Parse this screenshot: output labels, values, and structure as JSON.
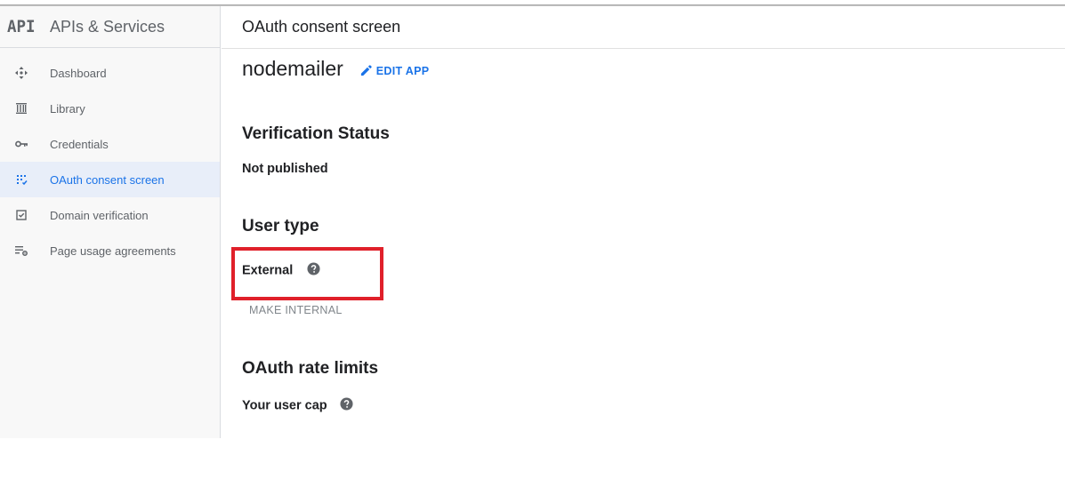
{
  "sidebar": {
    "logo_text": "API",
    "title": "APIs & Services",
    "items": [
      {
        "label": "Dashboard",
        "icon": "dashboard-icon"
      },
      {
        "label": "Library",
        "icon": "library-icon"
      },
      {
        "label": "Credentials",
        "icon": "key-icon"
      },
      {
        "label": "OAuth consent screen",
        "icon": "consent-grid-icon",
        "active": true
      },
      {
        "label": "Domain verification",
        "icon": "checkbox-icon"
      },
      {
        "label": "Page usage agreements",
        "icon": "list-settings-icon"
      }
    ]
  },
  "header": {
    "title": "OAuth consent screen"
  },
  "app": {
    "name": "nodemailer",
    "edit_label": "EDIT APP"
  },
  "verification": {
    "heading": "Verification Status",
    "status": "Not published"
  },
  "user_type": {
    "heading": "User type",
    "value": "External",
    "make_internal_label": "MAKE INTERNAL"
  },
  "rate_limits": {
    "heading": "OAuth rate limits",
    "user_cap_label": "Your user cap"
  },
  "colors": {
    "accent": "#1a73e8",
    "highlight_border": "#e0202a",
    "active_bg": "#e8eef9"
  }
}
